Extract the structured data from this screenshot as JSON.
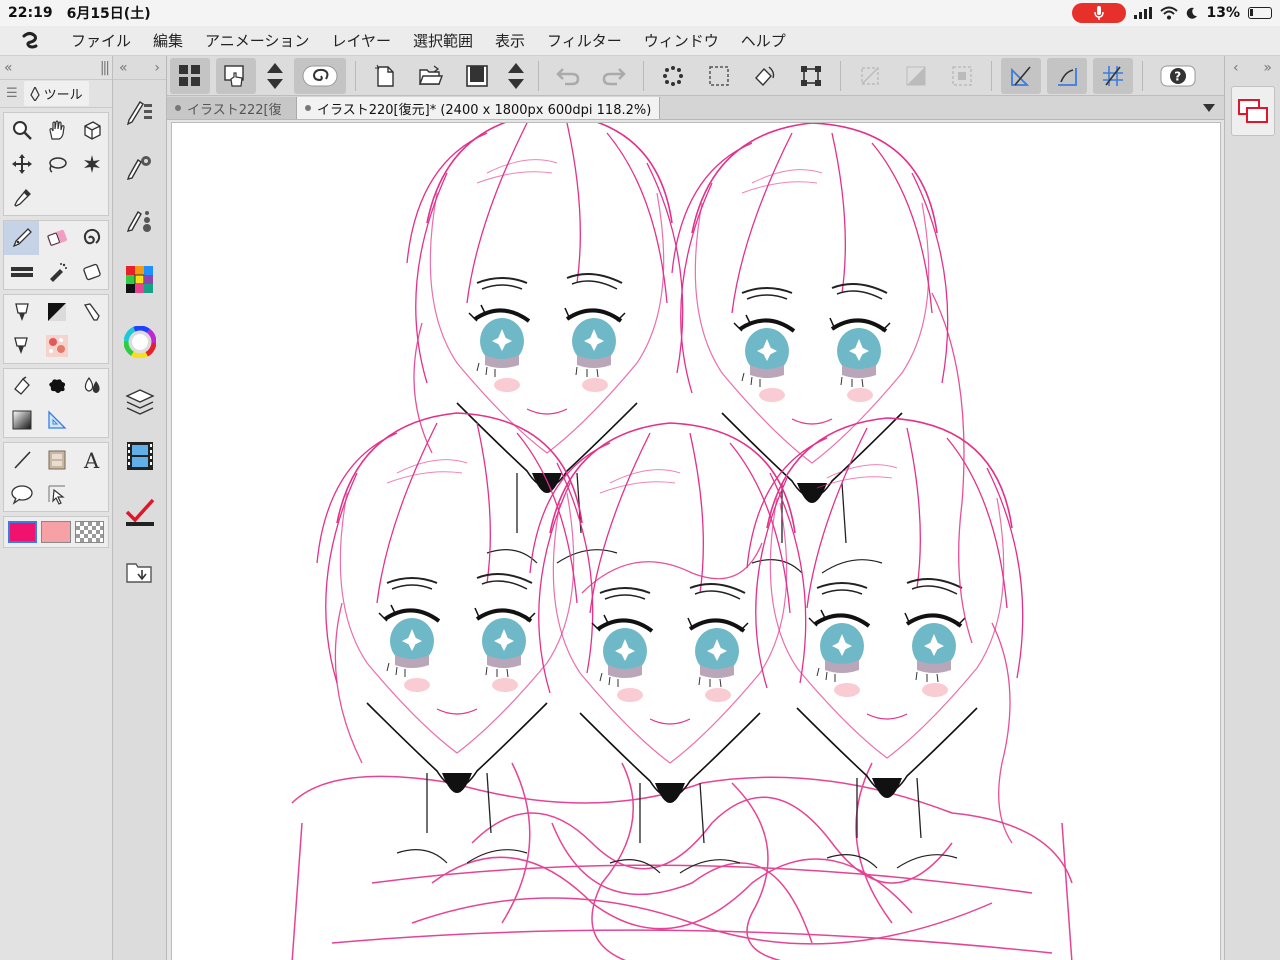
{
  "status": {
    "time": "22:19",
    "date": "6月15日(土)",
    "battery": "13%"
  },
  "menu": [
    "ファイル",
    "編集",
    "アニメーション",
    "レイヤー",
    "選択範囲",
    "表示",
    "フィルター",
    "ウィンドウ",
    "ヘルプ"
  ],
  "tabs": [
    {
      "label": "イラスト222[復"
    },
    {
      "label": "イラスト220[復元]* (2400 x 1800px 600dpi 118.2%)"
    }
  ],
  "tool_panel": {
    "tab_label": "ツール"
  },
  "colors": {
    "main": "#f0126e",
    "sub": "#f5a1a6",
    "accent": "#3a7de0",
    "sketch_pink": "#e3308a",
    "eye_blue": "#6fb8c8"
  }
}
